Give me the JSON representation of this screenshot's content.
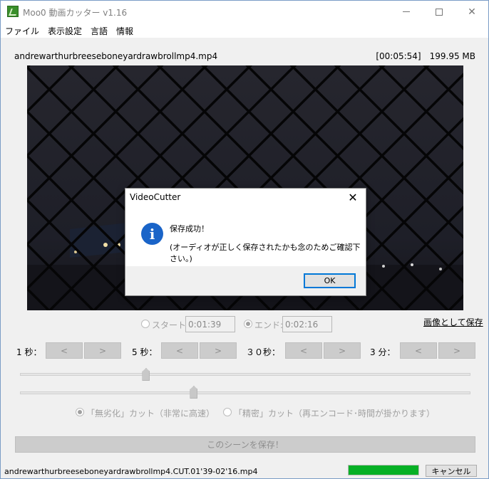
{
  "window": {
    "title": "Moo0 動画カッター v1.16"
  },
  "menu": [
    "ファイル",
    "表示設定",
    "言語",
    "情報"
  ],
  "file": {
    "name": "andrewarthurbreeseboneyardrawbrollmp4.mp4",
    "duration": "[00:05:54]",
    "size": "199.95 MB"
  },
  "dialog": {
    "title": "VideoCutter",
    "message": "保存成功！",
    "detail": "(オーディオが正しく保存されたかも念のためご確認下さい。)",
    "ok_label": "OK",
    "icon": "info-icon"
  },
  "range": {
    "start_label": "スタート:",
    "start_time": "0:01:39",
    "end_label": "エンド:",
    "end_time": "0:02:16",
    "start_selected": false,
    "end_selected": true
  },
  "save_image_label": "画像として保存",
  "steps": [
    {
      "label": "1 秒：",
      "prev": "<",
      "next": ">"
    },
    {
      "label": "5 秒：",
      "prev": "<",
      "next": ">"
    },
    {
      "label": "３０秒：",
      "prev": "<",
      "next": ">"
    },
    {
      "label": "3 分：",
      "prev": "<",
      "next": ">"
    }
  ],
  "sliders": {
    "start_fraction": 0.28,
    "end_fraction": 0.386
  },
  "cut_modes": {
    "lossless_label": "「無劣化」カット（非常に高速）",
    "precise_label": "「精密」カット（再エンコード･時間が掛かります）",
    "selected": "lossless"
  },
  "save_scene_label": "このシーンを保存！",
  "status": {
    "output_file": "andrewarthurbreeseboneyardrawbrollmp4.CUT.01'39-02'16.mp4",
    "progress": 1.0,
    "cancel_label": "キャンセル"
  },
  "colors": {
    "progress": "#06b025",
    "info_icon": "#1a64c8",
    "dialog_ok_border": "#0078d7"
  }
}
